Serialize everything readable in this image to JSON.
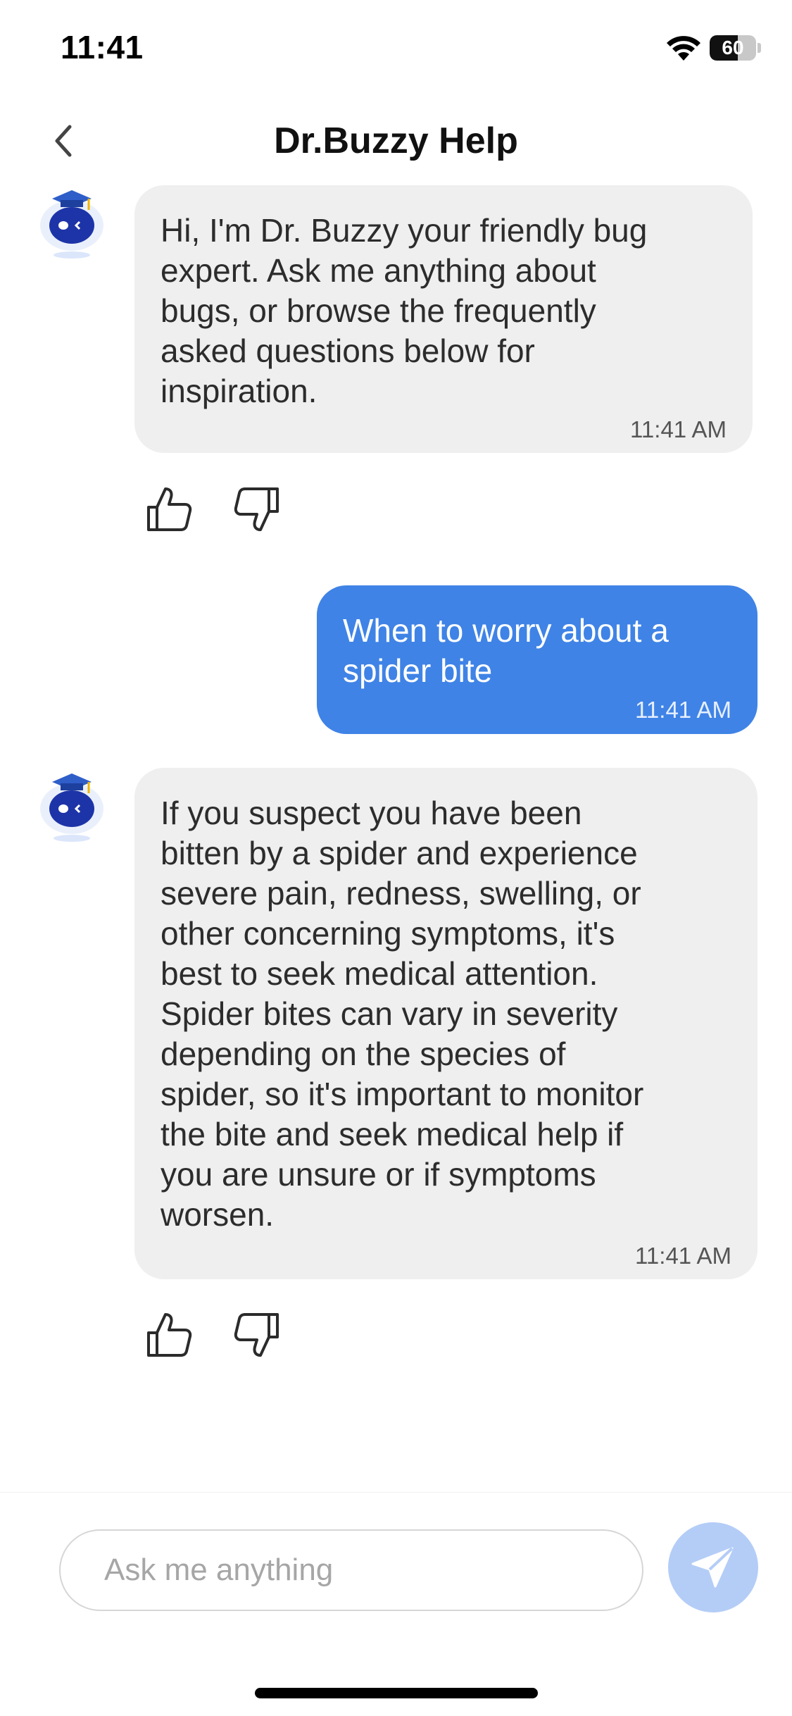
{
  "status_bar": {
    "time": "11:41",
    "battery_level": "60",
    "battery_fraction": 0.6
  },
  "nav": {
    "title": "Dr.Buzzy Help",
    "back_icon": "chevron-left-icon"
  },
  "messages": [
    {
      "sender": "bot",
      "text": "Hi, I'm Dr. Buzzy your friendly bug\nexpert. Ask me anything about\nbugs, or browse the frequently\nasked questions below for\ninspiration.",
      "time": "11:41 AM"
    },
    {
      "sender": "user",
      "text": "When to worry about a\nspider bite",
      "time": "11:41 AM"
    },
    {
      "sender": "bot",
      "text": "If you suspect you have been\nbitten by a spider and experience\nsevere pain, redness, swelling, or\nother concerning symptoms, it's\nbest to seek medical attention.\nSpider bites can vary in severity\ndepending on the species of\nspider, so it's important to monitor\nthe bite and seek medical help if\nyou are unsure or if symptoms\nworsen.",
      "time": "11:41 AM"
    }
  ],
  "feedback": {
    "like_icon": "thumbs-up-icon",
    "dislike_icon": "thumbs-down-icon"
  },
  "composer": {
    "placeholder": "Ask me anything",
    "value": "",
    "send_icon": "send-icon"
  },
  "colors": {
    "bot_bubble": "#efefef",
    "user_bubble": "#3f83e6",
    "send_button": "#b4cdf7",
    "avatar_blue": "#1a3fb0"
  }
}
